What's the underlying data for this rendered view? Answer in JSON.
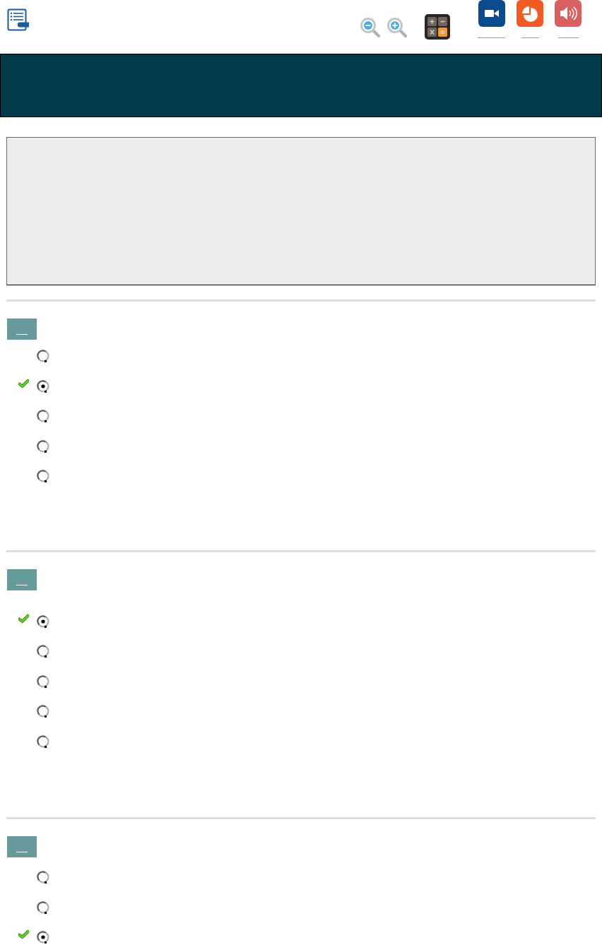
{
  "questions": [
    {
      "options": [
        {
          "selected": false,
          "correct": false
        },
        {
          "selected": true,
          "correct": true
        },
        {
          "selected": false,
          "correct": false
        },
        {
          "selected": false,
          "correct": false
        },
        {
          "selected": false,
          "correct": false
        }
      ]
    },
    {
      "options": [
        {
          "selected": true,
          "correct": true
        },
        {
          "selected": false,
          "correct": false
        },
        {
          "selected": false,
          "correct": false
        },
        {
          "selected": false,
          "correct": false
        },
        {
          "selected": false,
          "correct": false
        }
      ]
    },
    {
      "options": [
        {
          "selected": false,
          "correct": false
        },
        {
          "selected": false,
          "correct": false
        },
        {
          "selected": true,
          "correct": true
        }
      ]
    }
  ]
}
